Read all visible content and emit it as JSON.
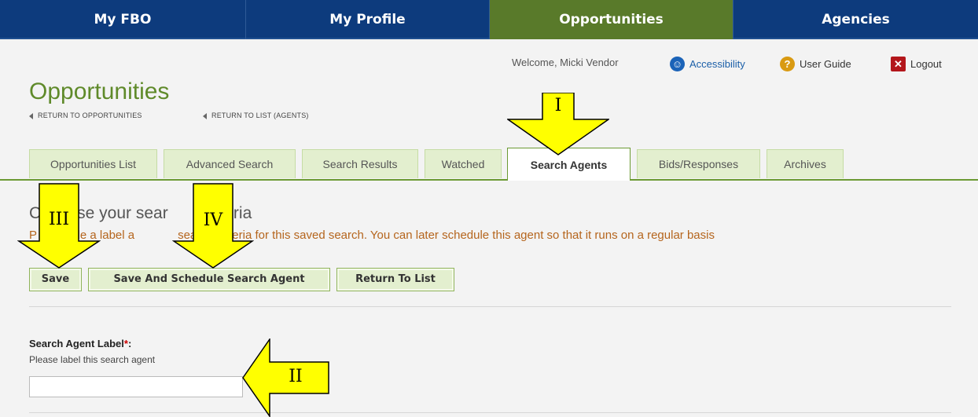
{
  "nav": [
    {
      "label": "My FBO",
      "active": false
    },
    {
      "label": "My Profile",
      "active": false
    },
    {
      "label": "Opportunities",
      "active": true
    },
    {
      "label": "Agencies",
      "active": false
    }
  ],
  "util": {
    "welcome": "Welcome, Micki Vendor",
    "accessibility": "Accessibility",
    "user_guide": "User Guide",
    "logout": "Logout"
  },
  "page": {
    "title": "Opportunities",
    "return_opps": "RETURN TO OPPORTUNITIES",
    "return_list": "RETURN TO LIST (AGENTS)"
  },
  "tabs": [
    "Opportunities List",
    "Advanced Search",
    "Search Results",
    "Watched",
    "Search Agents",
    "Bids/Responses",
    "Archives"
  ],
  "active_tab": "Search Agents",
  "section": {
    "title_start": "C",
    "title_mid": "se your sear",
    "title_end": "riteria",
    "instructions_start": "P",
    "instructions_mid": "provide a label a",
    "instructions_end": "search criteria for this saved search. You can later schedule this agent so that it runs on a regular basis"
  },
  "buttons": {
    "save": "Save",
    "save_schedule": "Save And Schedule Search Agent",
    "return": "Return To List"
  },
  "field": {
    "label": "Search Agent Label",
    "required": "*",
    "colon": ":",
    "help": "Please label this search agent",
    "value": ""
  },
  "callouts": {
    "one": "I",
    "two": "II",
    "three": "III",
    "four": "IV"
  },
  "colors": {
    "nav_blue": "#0d3b7d",
    "nav_active": "#597a2a",
    "accent_green": "#6b9a33",
    "tab_bg": "#e3efcf",
    "instruction": "#b5651d",
    "callout": "#ffff00"
  }
}
